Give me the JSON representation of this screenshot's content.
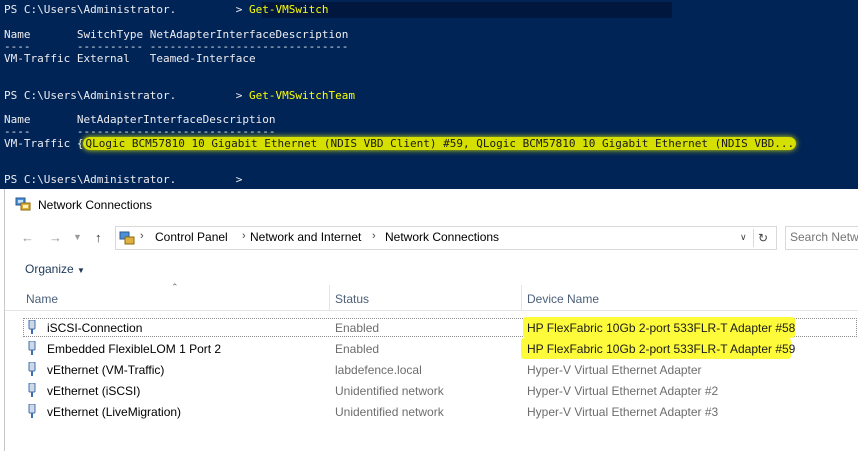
{
  "console": {
    "lines": [
      {
        "prompt": "PS C:\\Users\\Administrator.         > ",
        "command": "Get-VMSwitch"
      },
      {
        "text": "Name       SwitchType NetAdapterInterfaceDescription"
      },
      {
        "text": "----       ---------- ------------------------------"
      },
      {
        "text": "VM-Traffic External   Teamed-Interface"
      },
      {
        "prompt": "PS C:\\Users\\Administrator.         > ",
        "command": "Get-VMSwitchTeam"
      },
      {
        "text": "Name       NetAdapterInterfaceDescription"
      },
      {
        "text": "----       ------------------------------"
      },
      {
        "prefix": "VM-Traffic {",
        "highlight": "QLogic BCM57810 10 Gigabit Ethernet (NDIS VBD Client) #59, QLogic BCM57810 10 Gigabit Ethernet (NDIS VBD..."
      },
      {
        "prompt": "PS C:\\Users\\Administrator.         > "
      }
    ]
  },
  "window": {
    "title": "Network Connections",
    "breadcrumbs": [
      "Control Panel",
      "Network and Internet",
      "Network Connections"
    ],
    "search_placeholder": "Search Netw",
    "organize_label": "Organize",
    "columns": {
      "name": "Name",
      "status": "Status",
      "device": "Device Name"
    },
    "rows": [
      {
        "name": "iSCSI-Connection",
        "status": "Enabled",
        "device": "HP FlexFabric 10Gb 2-port 533FLR-T Adapter #58"
      },
      {
        "name": "Embedded FlexibleLOM 1 Port 2",
        "status": "Enabled",
        "device": "HP FlexFabric 10Gb 2-port 533FLR-T Adapter #59"
      },
      {
        "name": "vEthernet (VM-Traffic)",
        "status": "labdefence.local",
        "device": "Hyper-V Virtual Ethernet Adapter"
      },
      {
        "name": "vEthernet (iSCSI)",
        "status": "Unidentified network",
        "device": "Hyper-V Virtual Ethernet Adapter #2"
      },
      {
        "name": "vEthernet (LiveMigration)",
        "status": "Unidentified network",
        "device": "Hyper-V Virtual Ethernet Adapter #3"
      }
    ]
  },
  "colors": {
    "console_bg": "#012456",
    "console_command": "#ffff00",
    "highlight": "#fdfb3a"
  },
  "icons": {
    "window": "network-connections-icon",
    "adapter": "network-adapter-icon",
    "refresh": "refresh-icon"
  }
}
